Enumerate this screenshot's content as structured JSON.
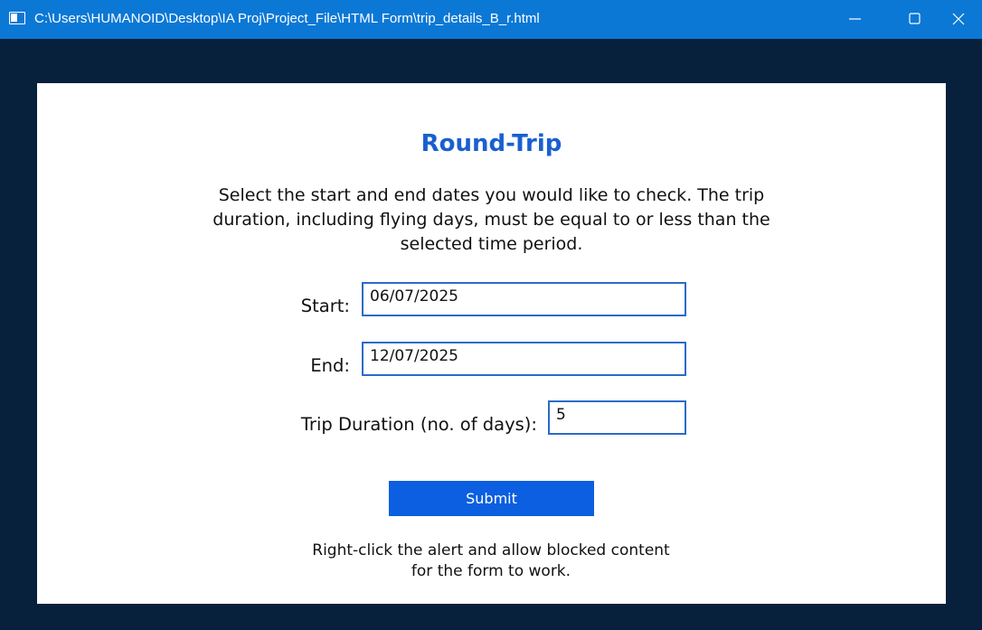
{
  "window": {
    "title": "C:\\Users\\HUMANOID\\Desktop\\IA Proj\\Project_File\\HTML Form\\trip_details_B_r.html"
  },
  "form": {
    "heading": "Round-Trip",
    "description": "Select the start and end dates you would like to check. The trip duration, including flying days, must be equal to or less than the selected time period.",
    "start_label": "Start:",
    "start_value": "06/07/2025",
    "end_label": "End:",
    "end_value": "12/07/2025",
    "duration_label": "Trip Duration (no. of days):",
    "duration_value": "5",
    "submit_label": "Submit",
    "note": "Right-click the alert and allow blocked content for the form to work."
  },
  "colors": {
    "titlebar": "#0b78d6",
    "background": "#07203c",
    "heading": "#1a5fd0",
    "button": "#0b5fe0",
    "field_border": "#2a6bc9"
  },
  "icons": [
    "app-window-icon",
    "minimize-icon",
    "maximize-icon",
    "close-icon"
  ]
}
